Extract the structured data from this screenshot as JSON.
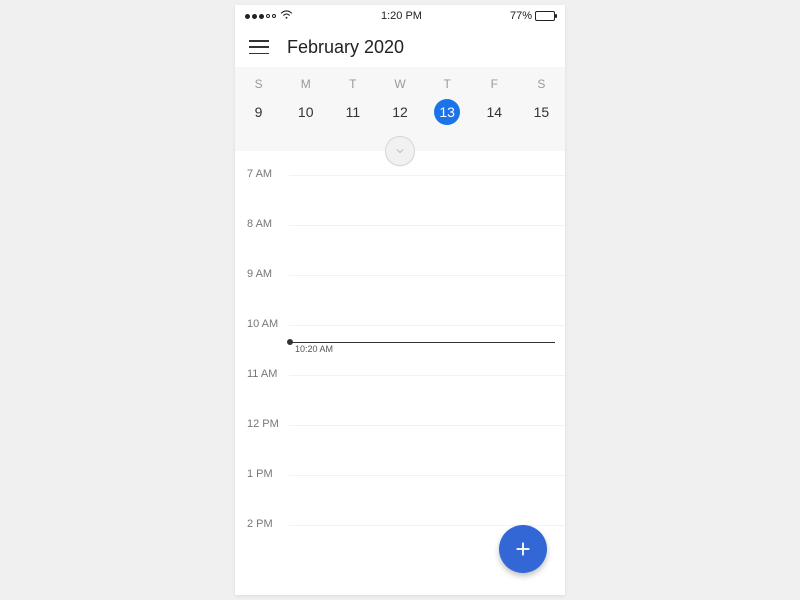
{
  "status": {
    "time": "1:20 PM",
    "battery_pct": "77%"
  },
  "header": {
    "title": "February 2020"
  },
  "week": {
    "dow": [
      "S",
      "M",
      "T",
      "W",
      "T",
      "F",
      "S"
    ],
    "days": [
      "9",
      "10",
      "11",
      "12",
      "13",
      "14",
      "15"
    ],
    "selected_index": 4
  },
  "hours": [
    "7 AM",
    "8 AM",
    "9 AM",
    "10 AM",
    "11 AM",
    "12 PM",
    "1 PM",
    "2 PM"
  ],
  "now": {
    "label": "10:20 AM",
    "after_hour_index": 3,
    "fraction": 0.33
  }
}
